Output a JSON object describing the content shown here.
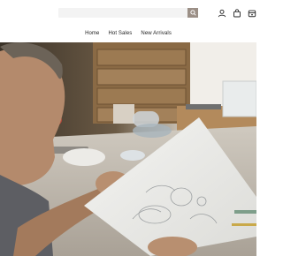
{
  "search": {
    "placeholder": ""
  },
  "header": {
    "icons": [
      "user-icon",
      "cart-icon",
      "bag-icon"
    ]
  },
  "nav": {
    "items": [
      {
        "label": "Home"
      },
      {
        "label": "Hot Sales"
      },
      {
        "label": "New Arrivals"
      }
    ]
  },
  "hero": {
    "image": "photo-of-artisan-examining-jewelry-sketch"
  },
  "colors": {
    "search_button": "#9b8f86",
    "background": "#ffffff",
    "nav_text": "#222222"
  }
}
